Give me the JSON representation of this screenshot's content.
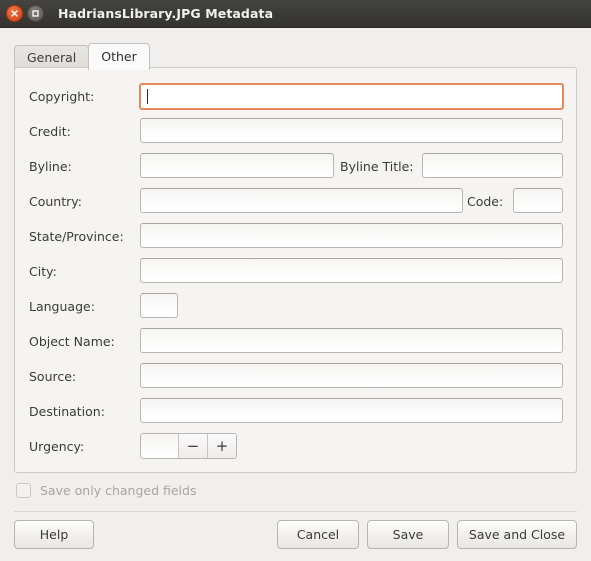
{
  "window": {
    "title": "HadriansLibrary.JPG Metadata",
    "close_icon": "close-icon",
    "maximize_icon": "maximize-icon",
    "titlebar_color": "#3c3b37",
    "background_color": "#f0efed"
  },
  "tabs": [
    {
      "label": "General",
      "active": false
    },
    {
      "label": "Other",
      "active": true
    }
  ],
  "form": {
    "focus_color": "#e8875a",
    "rows": [
      {
        "label": "Copyright:",
        "value": "",
        "focused": true
      },
      {
        "label": "Credit:",
        "value": "",
        "focused": false
      },
      {
        "label": "Byline:",
        "value": "",
        "focused": false
      },
      {
        "label": "Byline Title:",
        "value": "",
        "focused": false
      },
      {
        "label": "Country:",
        "value": "",
        "focused": false
      },
      {
        "label": "Code:",
        "value": "",
        "focused": false
      },
      {
        "label": "State/Province:",
        "value": "",
        "focused": false
      },
      {
        "label": "City:",
        "value": "",
        "focused": false
      },
      {
        "label": "Language:",
        "value": "",
        "focused": false
      },
      {
        "label": "Object Name:",
        "value": "",
        "focused": false
      },
      {
        "label": "Source:",
        "value": "",
        "focused": false
      },
      {
        "label": "Destination:",
        "value": "",
        "focused": false
      },
      {
        "label": "Urgency:",
        "value": "",
        "focused": false
      }
    ],
    "urgency_spinner": {
      "value": "",
      "decrement_label": "−",
      "increment_label": "+"
    }
  },
  "options": {
    "save_only_changed": {
      "label": "Save only changed fields",
      "checked": false,
      "enabled": false
    }
  },
  "footer": {
    "help_label": "Help",
    "cancel_label": "Cancel",
    "save_label": "Save",
    "save_and_close_label": "Save and Close"
  }
}
